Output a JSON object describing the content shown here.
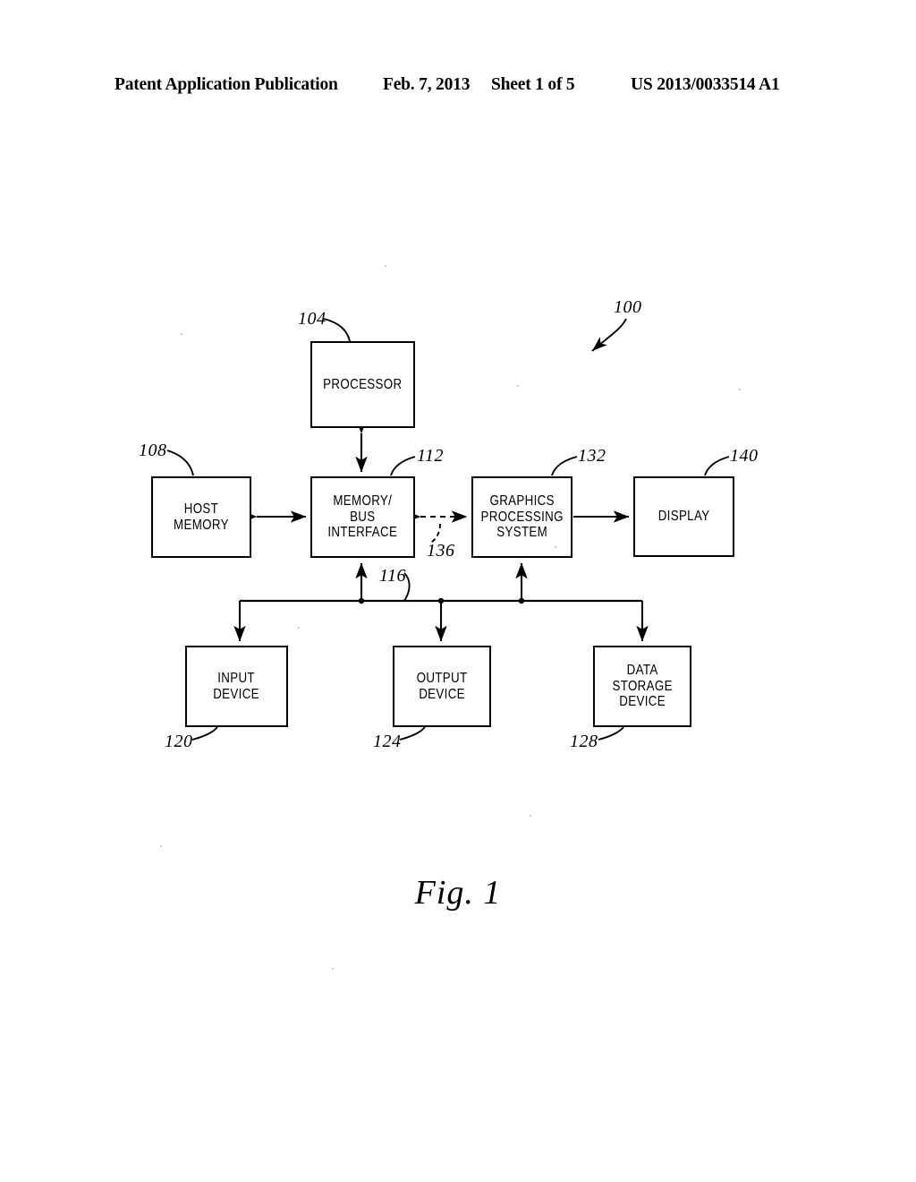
{
  "header": {
    "publication": "Patent Application Publication",
    "date": "Feb. 7, 2013",
    "sheet": "Sheet 1 of 5",
    "number": "US 2013/0033514 A1"
  },
  "figure": {
    "caption": "Fig.  1",
    "system_ref": "100",
    "blocks": [
      {
        "id": "processor",
        "label": "PROCESSOR",
        "ref": "104"
      },
      {
        "id": "host_memory",
        "label": "HOST\nMEMORY",
        "ref": "108"
      },
      {
        "id": "memory_bus",
        "label": "MEMORY/\nBUS\nINTERFACE",
        "ref": "112"
      },
      {
        "id": "gps",
        "label": "GRAPHICS\nPROCESSING\nSYSTEM",
        "ref": "132"
      },
      {
        "id": "display",
        "label": "DISPLAY",
        "ref": "140"
      },
      {
        "id": "input",
        "label": "INPUT\nDEVICE",
        "ref": "120"
      },
      {
        "id": "output",
        "label": "OUTPUT\nDEVICE",
        "ref": "124"
      },
      {
        "id": "storage",
        "label": "DATA\nSTORAGE\nDEVICE",
        "ref": "128"
      }
    ],
    "connections": [
      {
        "id": "bus",
        "ref": "116",
        "from": "memory_bus",
        "to": "input,output,storage",
        "style": "solid",
        "arrows": "both"
      },
      {
        "id": "gps_link",
        "ref": "136",
        "from": "memory_bus",
        "to": "gps",
        "style": "dashed",
        "arrows": "both"
      }
    ],
    "colors": {
      "ink": "#000000",
      "paper": "#ffffff"
    }
  }
}
